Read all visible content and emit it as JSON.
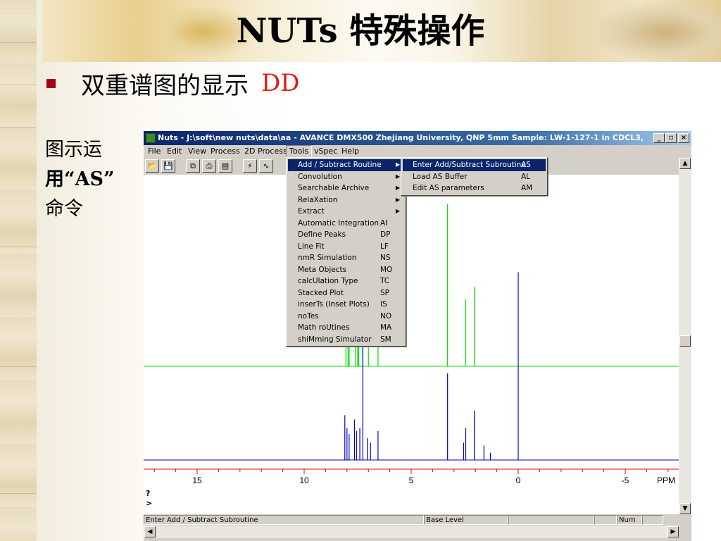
{
  "slide": {
    "title": "NUTs 特殊操作",
    "bullet_text": "双重谱图的显示",
    "bullet_accent": "DD",
    "side_note_lines": [
      "图示运",
      "用“AS”",
      "命令"
    ]
  },
  "window": {
    "title": "Nuts - J:\\soft\\new nuts\\data\\aa - AVANCE DMX500 Zhejiang University, QNP 5mm Sample: LW-1-127-1 in CDCL3,",
    "controls": {
      "minimize": "_",
      "restore": "▫",
      "close": "×"
    }
  },
  "menubar": [
    "File",
    "Edit",
    "View",
    "Process",
    "2D Process",
    "Tools",
    "vSpec",
    "Help"
  ],
  "toolbar_icons": [
    "open-folder-icon",
    "save-icon",
    "copy-icon",
    "print-icon",
    "properties-icon",
    "fourier-transform-icon",
    "phase-icon"
  ],
  "tools_menu": [
    {
      "label": "Add / Subtract Routine",
      "shortcut": "",
      "submenu": true,
      "highlighted": true
    },
    {
      "label": "Convolution",
      "shortcut": "",
      "submenu": true
    },
    {
      "label": "Searchable Archive",
      "shortcut": "",
      "submenu": true
    },
    {
      "label": "RelaXation",
      "shortcut": "",
      "submenu": true
    },
    {
      "label": "Extract",
      "shortcut": "",
      "submenu": true
    },
    {
      "label": "Automatic Integration",
      "shortcut": "AI"
    },
    {
      "label": "Define Peaks",
      "shortcut": "DP"
    },
    {
      "label": "Line Fit",
      "shortcut": "LF"
    },
    {
      "label": "nmR Simulation",
      "shortcut": "NS"
    },
    {
      "label": "Meta Objects",
      "shortcut": "MO"
    },
    {
      "label": "calcUlation Type",
      "shortcut": "TC"
    },
    {
      "label": "Stacked Plot",
      "shortcut": "SP"
    },
    {
      "label": "inserTs (Inset Plots)",
      "shortcut": "IS"
    },
    {
      "label": "noTes",
      "shortcut": "NO"
    },
    {
      "label": "Math roUtines",
      "shortcut": "MA"
    },
    {
      "label": "shiMming Simulator",
      "shortcut": "SM"
    }
  ],
  "submenu": [
    {
      "label": "Enter Add/Subtract Subroutine",
      "shortcut": "AS",
      "highlighted": true
    },
    {
      "label": "Load AS Buffer",
      "shortcut": "AL"
    },
    {
      "label": "Edit AS parameters",
      "shortcut": "AM"
    }
  ],
  "axis": {
    "ticks": [
      {
        "v": 15,
        "label": "15"
      },
      {
        "v": 10,
        "label": "10"
      },
      {
        "v": 5,
        "label": "5"
      },
      {
        "v": 0,
        "label": "0"
      },
      {
        "v": -5,
        "label": "-5"
      }
    ],
    "unit": "PPM",
    "min": -7.5,
    "max": 17.5
  },
  "spectra": {
    "green_color": "#00dd00",
    "blue_color": "#0000cc",
    "axis_color": "#ee0000",
    "green_peaks": [
      {
        "ppm": 8.05,
        "h": 0.3
      },
      {
        "ppm": 7.95,
        "h": 0.2
      },
      {
        "ppm": 7.9,
        "h": 0.25
      },
      {
        "ppm": 7.6,
        "h": 0.28
      },
      {
        "ppm": 7.5,
        "h": 0.24
      },
      {
        "ppm": 7.45,
        "h": 0.2
      },
      {
        "ppm": 7.26,
        "h": 1.0
      },
      {
        "ppm": 7.0,
        "h": 0.15
      },
      {
        "ppm": 6.55,
        "h": 0.22
      },
      {
        "ppm": 3.3,
        "h": 0.92
      },
      {
        "ppm": 2.45,
        "h": 0.38
      },
      {
        "ppm": 2.05,
        "h": 0.45
      }
    ],
    "blue_peaks": [
      {
        "ppm": 8.1,
        "h": 0.31
      },
      {
        "ppm": 8.0,
        "h": 0.22
      },
      {
        "ppm": 7.9,
        "h": 0.18
      },
      {
        "ppm": 7.65,
        "h": 0.28
      },
      {
        "ppm": 7.55,
        "h": 0.2
      },
      {
        "ppm": 7.4,
        "h": 0.22
      },
      {
        "ppm": 7.26,
        "h": 1.0
      },
      {
        "ppm": 7.05,
        "h": 0.15
      },
      {
        "ppm": 6.9,
        "h": 0.12
      },
      {
        "ppm": 6.55,
        "h": 0.2
      },
      {
        "ppm": 3.3,
        "h": 0.6
      },
      {
        "ppm": 2.55,
        "h": 0.12
      },
      {
        "ppm": 2.45,
        "h": 0.22
      },
      {
        "ppm": 2.05,
        "h": 0.34
      },
      {
        "ppm": 1.6,
        "h": 0.1
      },
      {
        "ppm": 1.3,
        "h": 0.05
      },
      {
        "ppm": 0.0,
        "h": 1.3
      }
    ]
  },
  "console": {
    "line1": "?",
    "line2": ">"
  },
  "statusbar": {
    "left": "Enter Add / Subtract Subroutine",
    "middle": "Base Level",
    "blank1": "",
    "blank2": "",
    "num": "Num",
    "blank3": ""
  }
}
